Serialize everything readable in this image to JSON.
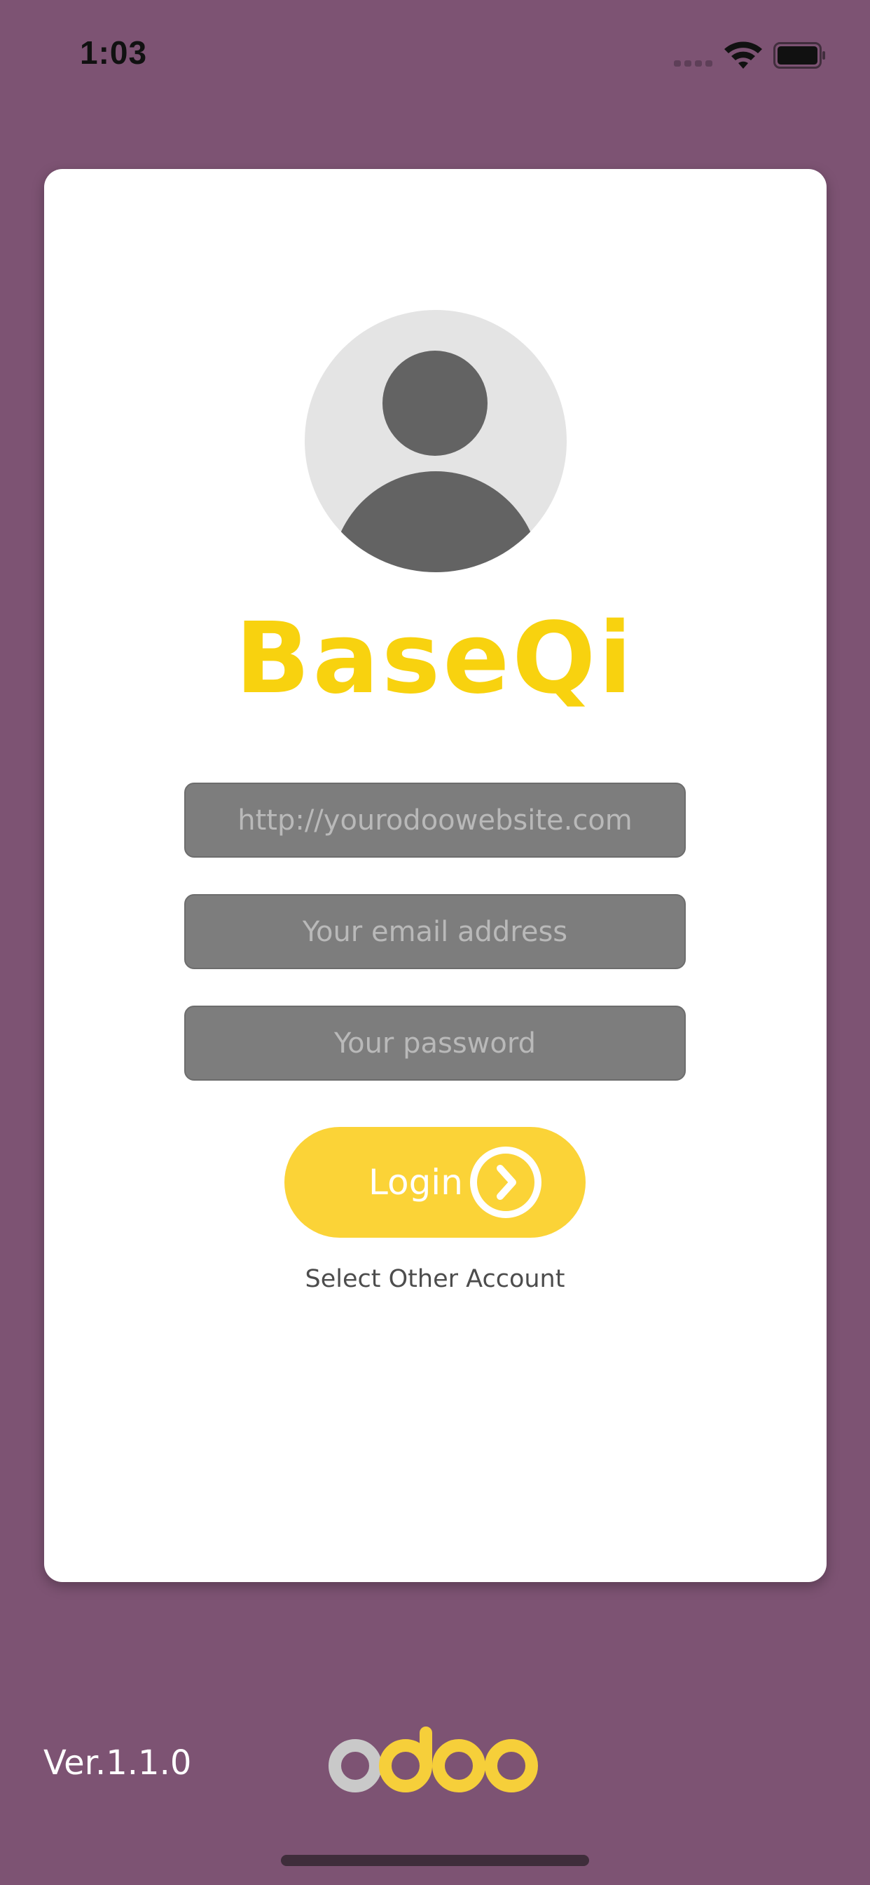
{
  "status_bar": {
    "time": "1:03",
    "signal_icon": "cellular-signal-icon",
    "wifi_icon": "wifi-icon",
    "battery_icon": "battery-icon"
  },
  "login_card": {
    "avatar_icon": "user-avatar-icon",
    "brand_title": "BaseQi",
    "url_field": {
      "value": "",
      "placeholder": "http://yourodoowebsite.com"
    },
    "email_field": {
      "value": "",
      "placeholder": "Your email address"
    },
    "password_field": {
      "value": "",
      "placeholder": "Your password"
    },
    "login_button": {
      "label": "Login",
      "icon": "chevron-right-circle-icon"
    },
    "select_account_link": "Select Other Account"
  },
  "footer": {
    "version": "Ver.1.1.0",
    "logo": "odoo",
    "logo_icon": "odoo-logo-icon"
  },
  "colors": {
    "background": "#7d5373",
    "card": "#ffffff",
    "brand_yellow": "#f8d20f",
    "button_yellow": "#fbd337",
    "field_gray": "#7d7d7d",
    "avatar_dark": "#636363",
    "avatar_light": "#e4e4e4"
  }
}
